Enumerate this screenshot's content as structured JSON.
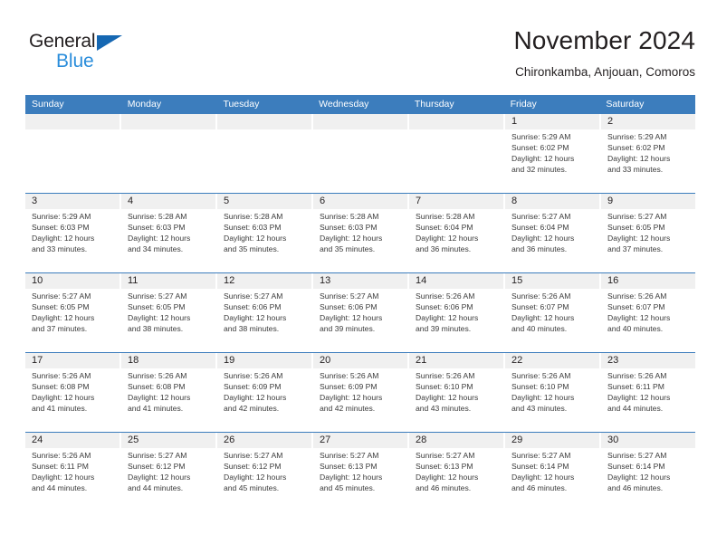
{
  "logo": {
    "word_dark": "General",
    "word_blue": "Blue",
    "triangle_color": "#1567b2",
    "blue_color": "#2a8ddb"
  },
  "header": {
    "title": "November 2024",
    "subtitle": "Chironkamba, Anjouan, Comoros"
  },
  "theme": {
    "header_blue": "#3c7dbd",
    "daynum_band": "#f0f0f0",
    "text": "#231f20"
  },
  "weekdays": [
    "Sunday",
    "Monday",
    "Tuesday",
    "Wednesday",
    "Thursday",
    "Friday",
    "Saturday"
  ],
  "weeks": [
    [
      {
        "day": "",
        "l1": "",
        "l2": "",
        "l3": "",
        "l4": ""
      },
      {
        "day": "",
        "l1": "",
        "l2": "",
        "l3": "",
        "l4": ""
      },
      {
        "day": "",
        "l1": "",
        "l2": "",
        "l3": "",
        "l4": ""
      },
      {
        "day": "",
        "l1": "",
        "l2": "",
        "l3": "",
        "l4": ""
      },
      {
        "day": "",
        "l1": "",
        "l2": "",
        "l3": "",
        "l4": ""
      },
      {
        "day": "1",
        "l1": "Sunrise: 5:29 AM",
        "l2": "Sunset: 6:02 PM",
        "l3": "Daylight: 12 hours",
        "l4": "and 32 minutes."
      },
      {
        "day": "2",
        "l1": "Sunrise: 5:29 AM",
        "l2": "Sunset: 6:02 PM",
        "l3": "Daylight: 12 hours",
        "l4": "and 33 minutes."
      }
    ],
    [
      {
        "day": "3",
        "l1": "Sunrise: 5:29 AM",
        "l2": "Sunset: 6:03 PM",
        "l3": "Daylight: 12 hours",
        "l4": "and 33 minutes."
      },
      {
        "day": "4",
        "l1": "Sunrise: 5:28 AM",
        "l2": "Sunset: 6:03 PM",
        "l3": "Daylight: 12 hours",
        "l4": "and 34 minutes."
      },
      {
        "day": "5",
        "l1": "Sunrise: 5:28 AM",
        "l2": "Sunset: 6:03 PM",
        "l3": "Daylight: 12 hours",
        "l4": "and 35 minutes."
      },
      {
        "day": "6",
        "l1": "Sunrise: 5:28 AM",
        "l2": "Sunset: 6:03 PM",
        "l3": "Daylight: 12 hours",
        "l4": "and 35 minutes."
      },
      {
        "day": "7",
        "l1": "Sunrise: 5:28 AM",
        "l2": "Sunset: 6:04 PM",
        "l3": "Daylight: 12 hours",
        "l4": "and 36 minutes."
      },
      {
        "day": "8",
        "l1": "Sunrise: 5:27 AM",
        "l2": "Sunset: 6:04 PM",
        "l3": "Daylight: 12 hours",
        "l4": "and 36 minutes."
      },
      {
        "day": "9",
        "l1": "Sunrise: 5:27 AM",
        "l2": "Sunset: 6:05 PM",
        "l3": "Daylight: 12 hours",
        "l4": "and 37 minutes."
      }
    ],
    [
      {
        "day": "10",
        "l1": "Sunrise: 5:27 AM",
        "l2": "Sunset: 6:05 PM",
        "l3": "Daylight: 12 hours",
        "l4": "and 37 minutes."
      },
      {
        "day": "11",
        "l1": "Sunrise: 5:27 AM",
        "l2": "Sunset: 6:05 PM",
        "l3": "Daylight: 12 hours",
        "l4": "and 38 minutes."
      },
      {
        "day": "12",
        "l1": "Sunrise: 5:27 AM",
        "l2": "Sunset: 6:06 PM",
        "l3": "Daylight: 12 hours",
        "l4": "and 38 minutes."
      },
      {
        "day": "13",
        "l1": "Sunrise: 5:27 AM",
        "l2": "Sunset: 6:06 PM",
        "l3": "Daylight: 12 hours",
        "l4": "and 39 minutes."
      },
      {
        "day": "14",
        "l1": "Sunrise: 5:26 AM",
        "l2": "Sunset: 6:06 PM",
        "l3": "Daylight: 12 hours",
        "l4": "and 39 minutes."
      },
      {
        "day": "15",
        "l1": "Sunrise: 5:26 AM",
        "l2": "Sunset: 6:07 PM",
        "l3": "Daylight: 12 hours",
        "l4": "and 40 minutes."
      },
      {
        "day": "16",
        "l1": "Sunrise: 5:26 AM",
        "l2": "Sunset: 6:07 PM",
        "l3": "Daylight: 12 hours",
        "l4": "and 40 minutes."
      }
    ],
    [
      {
        "day": "17",
        "l1": "Sunrise: 5:26 AM",
        "l2": "Sunset: 6:08 PM",
        "l3": "Daylight: 12 hours",
        "l4": "and 41 minutes."
      },
      {
        "day": "18",
        "l1": "Sunrise: 5:26 AM",
        "l2": "Sunset: 6:08 PM",
        "l3": "Daylight: 12 hours",
        "l4": "and 41 minutes."
      },
      {
        "day": "19",
        "l1": "Sunrise: 5:26 AM",
        "l2": "Sunset: 6:09 PM",
        "l3": "Daylight: 12 hours",
        "l4": "and 42 minutes."
      },
      {
        "day": "20",
        "l1": "Sunrise: 5:26 AM",
        "l2": "Sunset: 6:09 PM",
        "l3": "Daylight: 12 hours",
        "l4": "and 42 minutes."
      },
      {
        "day": "21",
        "l1": "Sunrise: 5:26 AM",
        "l2": "Sunset: 6:10 PM",
        "l3": "Daylight: 12 hours",
        "l4": "and 43 minutes."
      },
      {
        "day": "22",
        "l1": "Sunrise: 5:26 AM",
        "l2": "Sunset: 6:10 PM",
        "l3": "Daylight: 12 hours",
        "l4": "and 43 minutes."
      },
      {
        "day": "23",
        "l1": "Sunrise: 5:26 AM",
        "l2": "Sunset: 6:11 PM",
        "l3": "Daylight: 12 hours",
        "l4": "and 44 minutes."
      }
    ],
    [
      {
        "day": "24",
        "l1": "Sunrise: 5:26 AM",
        "l2": "Sunset: 6:11 PM",
        "l3": "Daylight: 12 hours",
        "l4": "and 44 minutes."
      },
      {
        "day": "25",
        "l1": "Sunrise: 5:27 AM",
        "l2": "Sunset: 6:12 PM",
        "l3": "Daylight: 12 hours",
        "l4": "and 44 minutes."
      },
      {
        "day": "26",
        "l1": "Sunrise: 5:27 AM",
        "l2": "Sunset: 6:12 PM",
        "l3": "Daylight: 12 hours",
        "l4": "and 45 minutes."
      },
      {
        "day": "27",
        "l1": "Sunrise: 5:27 AM",
        "l2": "Sunset: 6:13 PM",
        "l3": "Daylight: 12 hours",
        "l4": "and 45 minutes."
      },
      {
        "day": "28",
        "l1": "Sunrise: 5:27 AM",
        "l2": "Sunset: 6:13 PM",
        "l3": "Daylight: 12 hours",
        "l4": "and 46 minutes."
      },
      {
        "day": "29",
        "l1": "Sunrise: 5:27 AM",
        "l2": "Sunset: 6:14 PM",
        "l3": "Daylight: 12 hours",
        "l4": "and 46 minutes."
      },
      {
        "day": "30",
        "l1": "Sunrise: 5:27 AM",
        "l2": "Sunset: 6:14 PM",
        "l3": "Daylight: 12 hours",
        "l4": "and 46 minutes."
      }
    ]
  ]
}
